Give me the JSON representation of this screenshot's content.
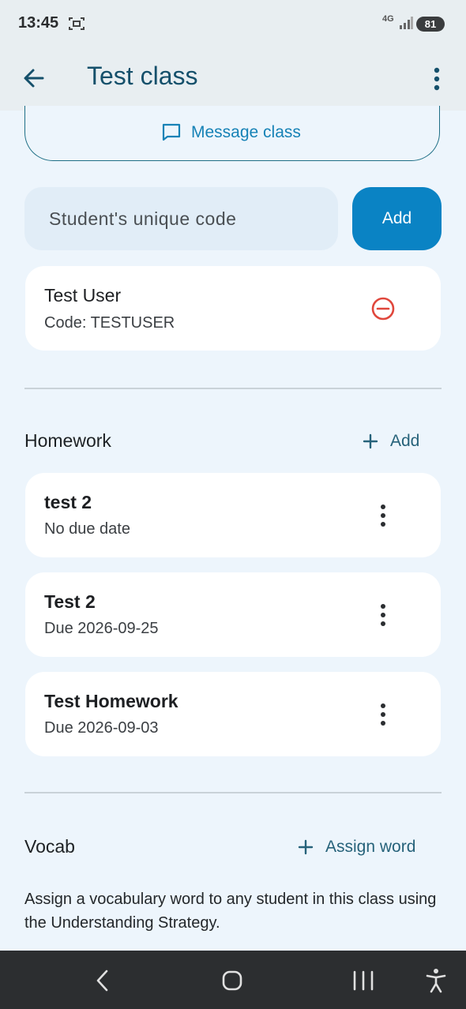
{
  "status_bar": {
    "time": "13:45",
    "network": "4G",
    "battery": "81"
  },
  "app_bar": {
    "title": "Test class"
  },
  "message_class": {
    "label": "Message class"
  },
  "student_code": {
    "placeholder": "Student's unique code",
    "add_label": "Add"
  },
  "students": [
    {
      "name": "Test User",
      "code": "Code: TESTUSER"
    }
  ],
  "homework": {
    "title": "Homework",
    "add_label": "Add",
    "items": [
      {
        "title": "test 2",
        "due": "No due date"
      },
      {
        "title": "Test 2",
        "due": "Due 2026-09-25"
      },
      {
        "title": "Test Homework",
        "due": "Due 2026-09-03"
      }
    ]
  },
  "vocab": {
    "title": "Vocab",
    "assign_label": "Assign word",
    "description": "Assign a vocabulary word to any student in this class using the Understanding Strategy."
  },
  "colors": {
    "primary": "#0a83c4",
    "title": "#15506b",
    "remove": "#e0473c",
    "background": "#edf5fc"
  }
}
